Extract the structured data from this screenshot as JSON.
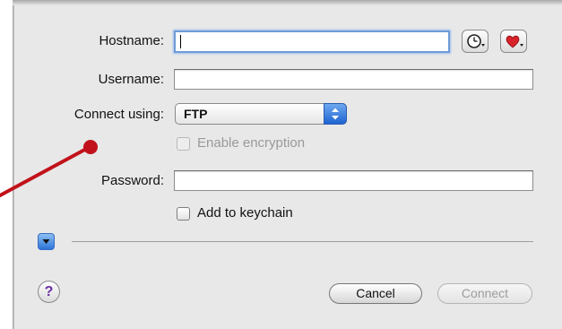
{
  "form": {
    "hostname_label": "Hostname:",
    "hostname_value": "",
    "username_label": "Username:",
    "username_value": "",
    "connect_using_label": "Connect using:",
    "connect_using_selected": "FTP",
    "enable_encryption_label": "Enable encryption",
    "enable_encryption_checked": false,
    "password_label": "Password:",
    "password_value": "",
    "add_to_keychain_label": "Add to keychain",
    "add_to_keychain_checked": false
  },
  "icons": {
    "history": "clock-icon",
    "favorites": "heart-icon",
    "disclosure": "disclosure-triangle-icon",
    "help": "help-icon",
    "annotation": "pointer-annotation"
  },
  "footer": {
    "help_glyph": "?",
    "cancel_label": "Cancel",
    "connect_label": "Connect"
  },
  "colors": {
    "focus_ring": "#6f9ad8",
    "popup_accent": "#1e64d2",
    "heart": "#d8232a",
    "annotation": "#c1121b",
    "help_glyph": "#6b2fa3"
  }
}
